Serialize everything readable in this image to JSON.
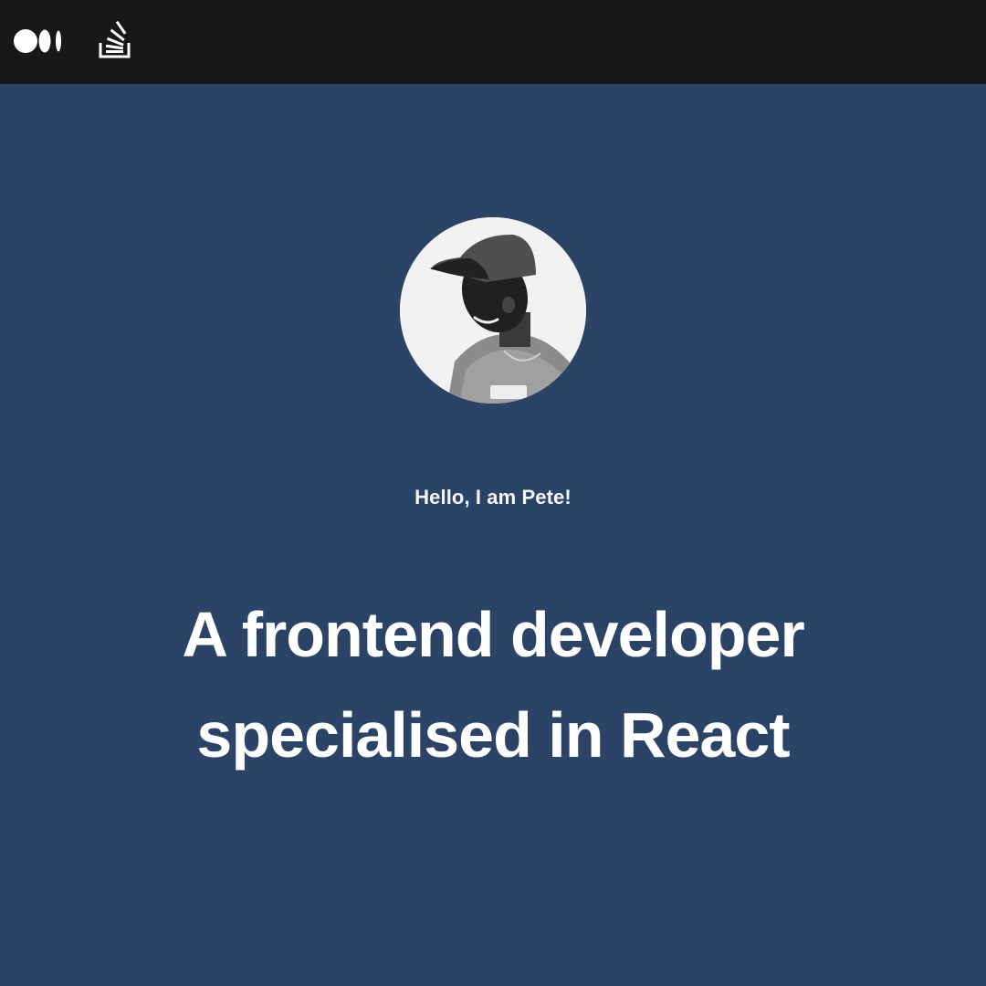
{
  "nav": {
    "icons": [
      "medium-icon",
      "stack-overflow-icon"
    ]
  },
  "hero": {
    "greeting": "Hello, I am Pete!",
    "headline_line1": "A frontend developer",
    "headline_line2": "specialised in React"
  },
  "colors": {
    "topbar": "#181818",
    "background": "#2b4366",
    "text": "#ffffff"
  }
}
